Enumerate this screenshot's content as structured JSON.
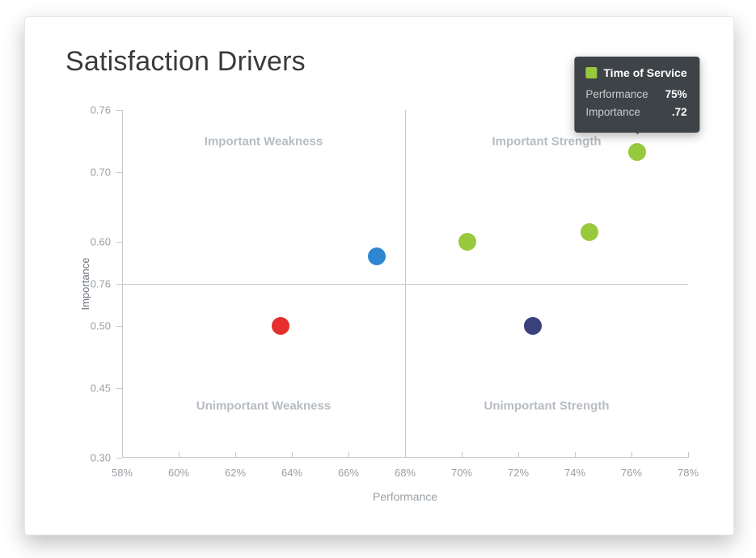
{
  "title": "Satisfaction Drivers",
  "chart_data": {
    "type": "scatter",
    "xlabel": "Performance",
    "ylabel": "Importance",
    "x_range_pct": [
      58,
      78
    ],
    "y_ticks": [
      {
        "label": "0.76",
        "frac": 0.0
      },
      {
        "label": "0.70",
        "frac": 0.18
      },
      {
        "label": "0.60",
        "frac": 0.38
      },
      {
        "label": "0.76",
        "frac": 0.5
      },
      {
        "label": "0.50",
        "frac": 0.62
      },
      {
        "label": "0.45",
        "frac": 0.8
      },
      {
        "label": "0.30",
        "frac": 1.0
      }
    ],
    "x_ticks_pct": [
      58,
      60,
      62,
      64,
      66,
      68,
      70,
      72,
      74,
      76,
      78
    ],
    "mid_x_pct": 68,
    "mid_y_frac": 0.5,
    "quadrants": {
      "top_left": "Important Weakness",
      "top_right": "Important Strength",
      "bottom_left": "Unimportant Weakness",
      "bottom_right": "Unimportant Strength"
    },
    "points": [
      {
        "name": "Time of Service",
        "color": "#98C93C",
        "x_pct": 76.2,
        "y_frac": 0.12,
        "performance": "75%",
        "importance": ".72"
      },
      {
        "name": "",
        "color": "#98C93C",
        "x_pct": 74.5,
        "y_frac": 0.35,
        "performance": "",
        "importance": ""
      },
      {
        "name": "",
        "color": "#98C93C",
        "x_pct": 70.2,
        "y_frac": 0.38,
        "performance": "",
        "importance": ""
      },
      {
        "name": "",
        "color": "#2E86D1",
        "x_pct": 67.0,
        "y_frac": 0.42,
        "performance": "",
        "importance": ""
      },
      {
        "name": "",
        "color": "#39407B",
        "x_pct": 72.5,
        "y_frac": 0.62,
        "performance": "",
        "importance": ""
      },
      {
        "name": "",
        "color": "#E62E2E",
        "x_pct": 63.6,
        "y_frac": 0.62,
        "performance": "",
        "importance": ""
      }
    ],
    "tooltip": {
      "point_index": 0,
      "series_label": "Time of Service",
      "swatch_color": "#98C93C",
      "rows": [
        {
          "k": "Performance",
          "v": "75%"
        },
        {
          "k": "Importance",
          "v": ".72"
        }
      ]
    }
  }
}
